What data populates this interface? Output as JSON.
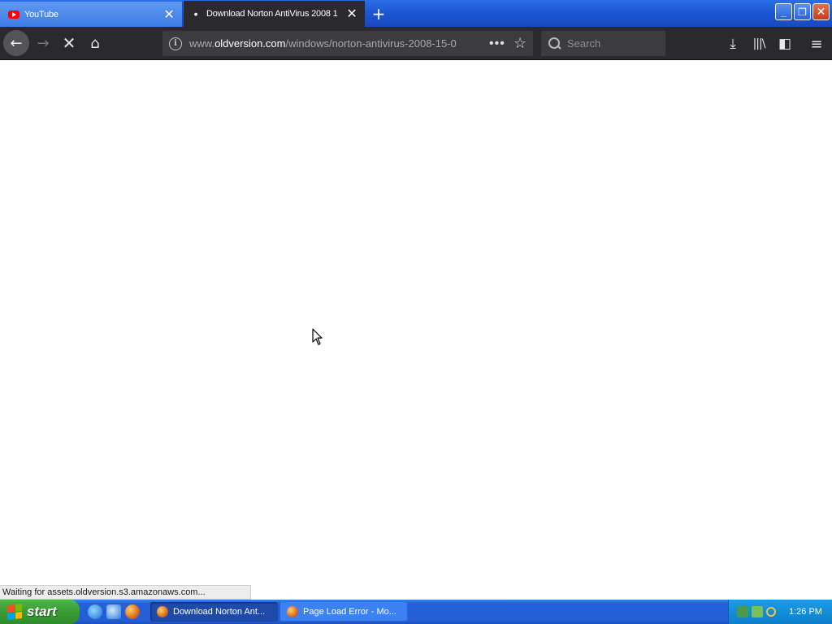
{
  "browser": {
    "tabs": [
      {
        "label": "YouTube",
        "icon": "youtube-icon",
        "active": false
      },
      {
        "label": "Download Norton AntiVirus 2008 1",
        "icon": "loading-dot-icon",
        "active": true
      }
    ],
    "tab_close_glyph": "✕",
    "newtab_glyph": "+",
    "window_controls": {
      "minimize": "_",
      "restore": "❐",
      "close": "✕"
    },
    "nav": {
      "back": "←",
      "forward": "→",
      "stop": "✕",
      "home": "⌂"
    },
    "url": {
      "prefix": "www.",
      "domain": "oldversion.com",
      "path": "/windows/norton-antivirus-2008-15-0"
    },
    "url_actions": {
      "page_actions": "•••",
      "bookmark": "☆"
    },
    "search": {
      "placeholder": "Search",
      "value": ""
    },
    "toolbar": {
      "downloads": "⤓",
      "library": "|||\\",
      "sidebar": "◧",
      "menu": "≡"
    },
    "status_text": "Waiting for assets.oldversion.s3.amazonaws.com..."
  },
  "taskbar": {
    "start_label": "start",
    "tasks": [
      {
        "label": "Download Norton Ant...",
        "active": true
      },
      {
        "label": "Page Load Error - Mo...",
        "active": false
      }
    ],
    "clock": "1:26 PM"
  },
  "colors": {
    "titlebar_blue": "#1d57d4",
    "toolbar_dark": "#2a2a2e",
    "taskbar_blue": "#245ed6",
    "start_green": "#3a9c35"
  }
}
